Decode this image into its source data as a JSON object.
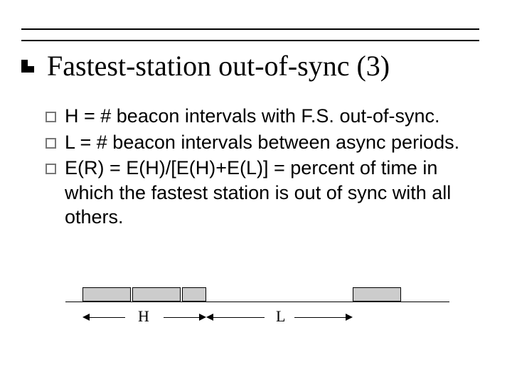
{
  "title": "Fastest-station out-of-sync (3)",
  "items": [
    "H = # beacon intervals with F.S. out-of-sync.",
    "L = # beacon intervals between async periods.",
    "E(R) = E(H)/[E(H)+E(L)] = percent of time in which the fastest station is out of sync with all others."
  ],
  "diagram": {
    "label_h": "H",
    "label_l": "L"
  }
}
